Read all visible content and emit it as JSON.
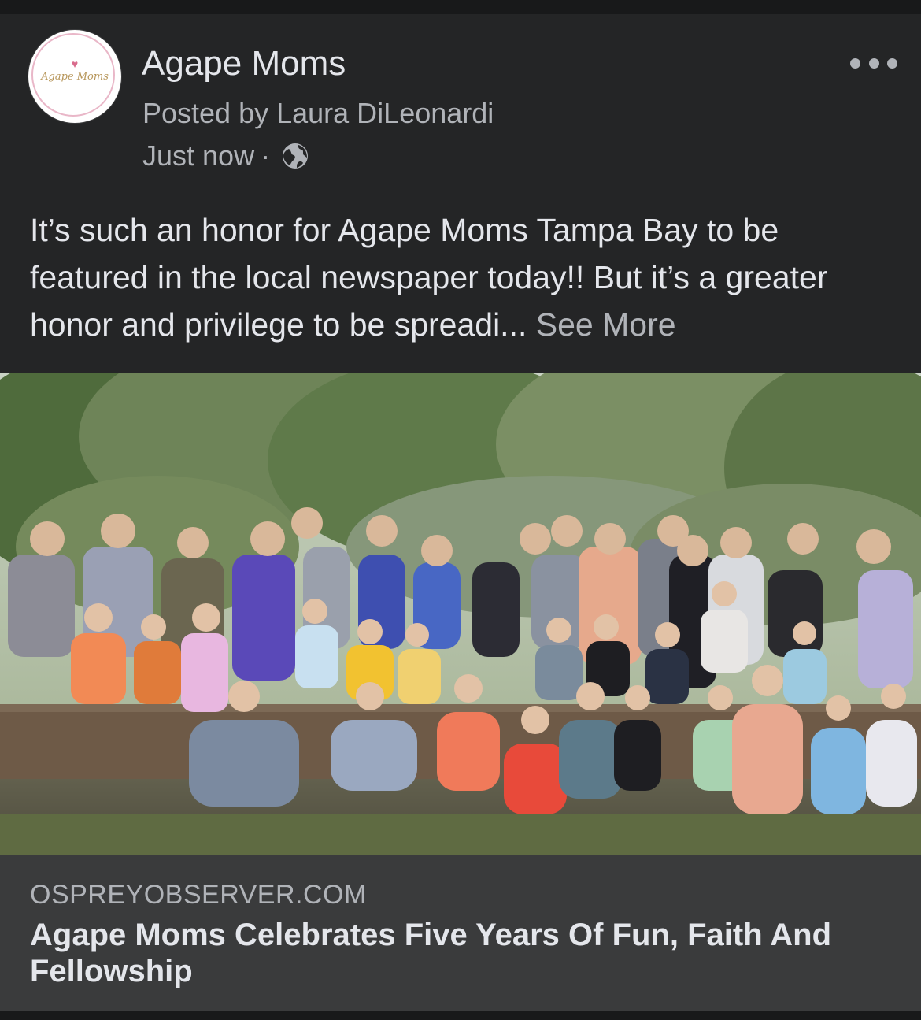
{
  "post": {
    "page_name": "Agape Moms",
    "avatar_text": "Agape Moms",
    "posted_by": "Posted by Laura DiLeonardi",
    "time": "Just now",
    "separator": "·",
    "privacy_icon": "globe-icon",
    "more_icon": "more-horizontal-icon",
    "text": "It’s such an honor for Agape Moms Tampa Bay to be featured in the local newspaper today!!  But it’s a greater honor and privilege to be spreadi...",
    "see_more": "See More"
  },
  "link_preview": {
    "domain": "OSPREYOBSERVER.COM",
    "title": "Agape Moms Celebrates Five Years Of Fun, Faith And Fellowship"
  },
  "colors": {
    "background": "#18191a",
    "card": "#242526",
    "footer": "#3a3b3c",
    "primary_text": "#e4e6eb",
    "secondary_text": "#b0b3b8"
  }
}
